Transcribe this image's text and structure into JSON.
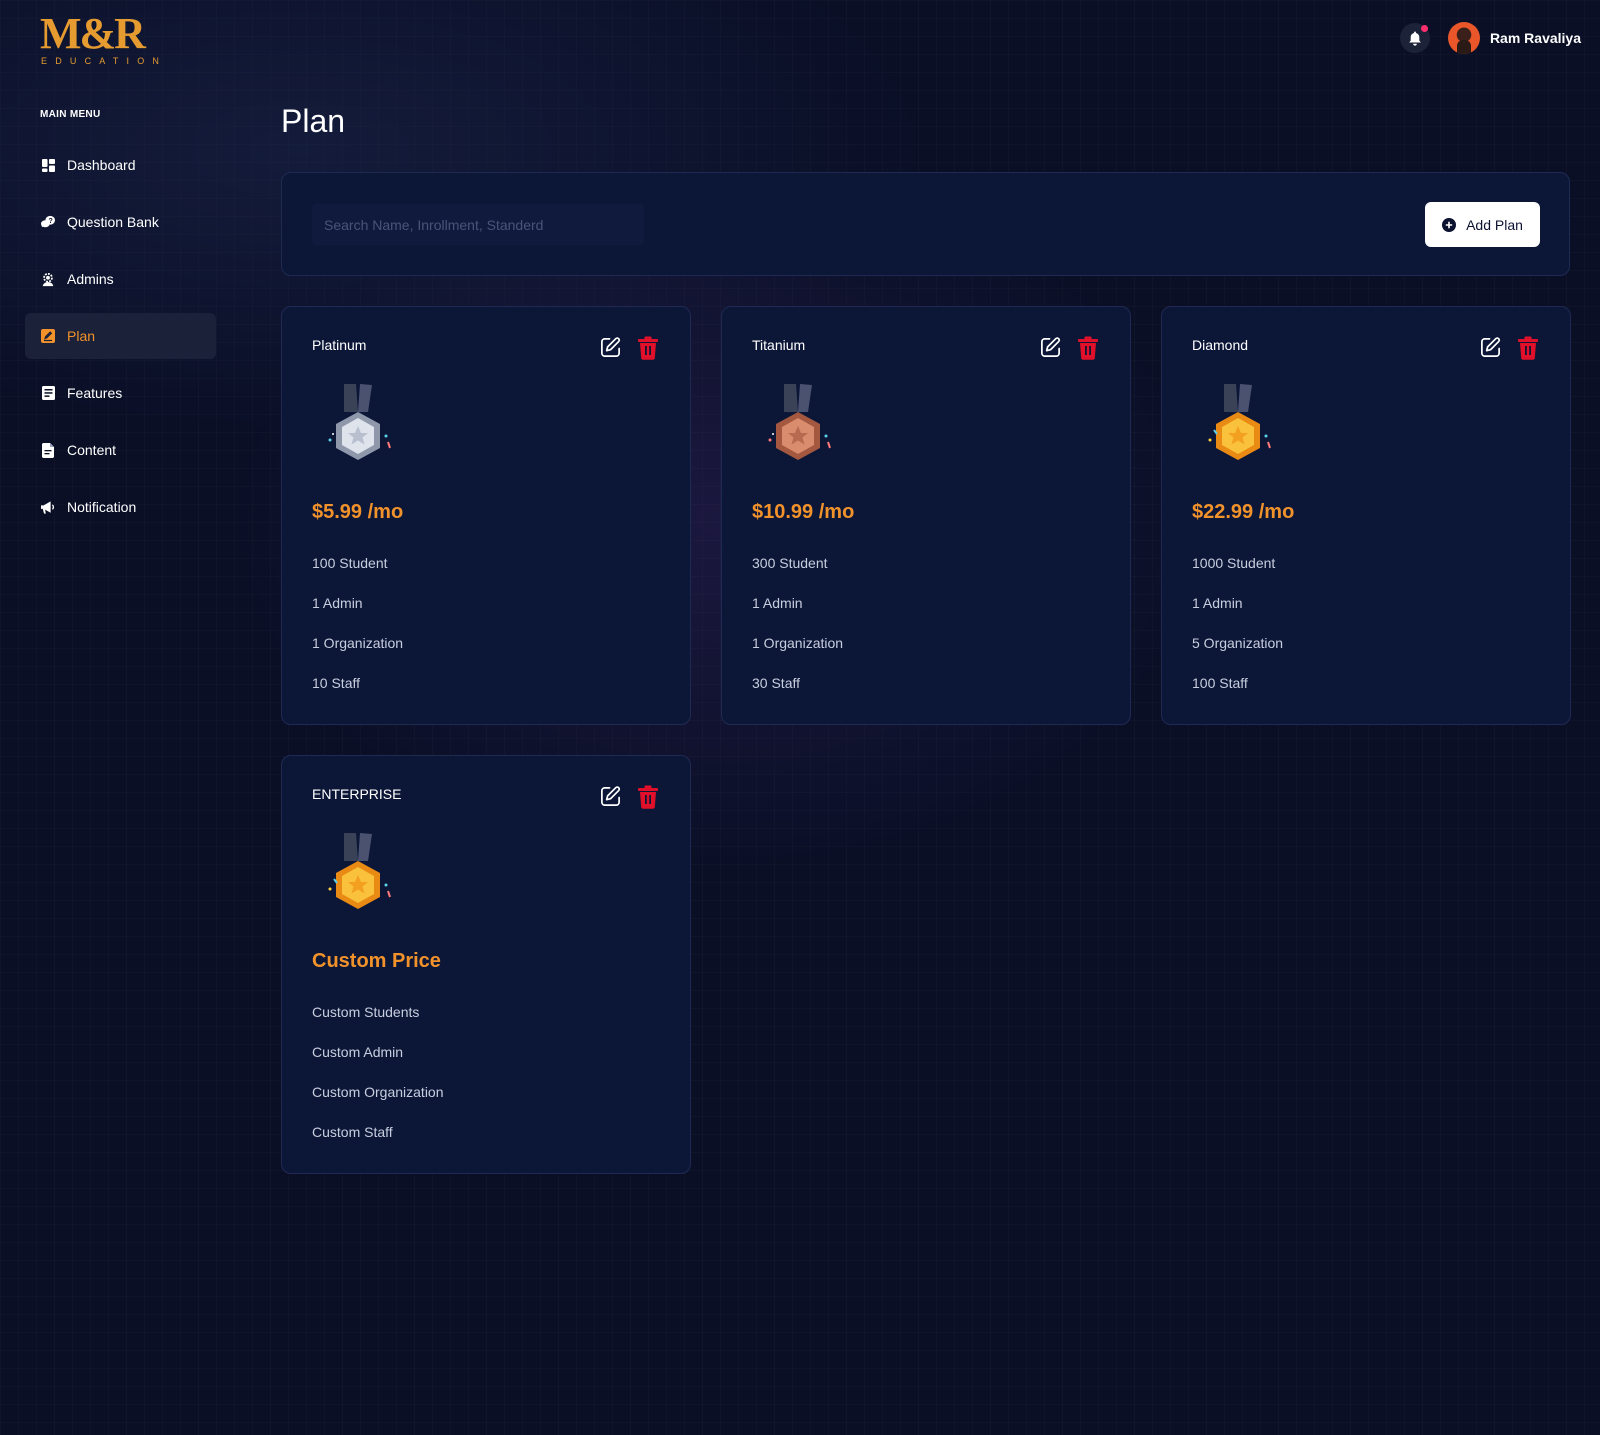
{
  "logo": {
    "main": "M&R",
    "sub": "EDUCATION"
  },
  "user": {
    "name": "Ram Ravaliya"
  },
  "sidebar": {
    "title": "MAIN MENU",
    "items": [
      {
        "label": "Dashboard",
        "icon": "dashboard-icon"
      },
      {
        "label": "Question Bank",
        "icon": "question-bank-icon"
      },
      {
        "label": "Admins",
        "icon": "admin-icon"
      },
      {
        "label": "Plan",
        "icon": "plan-icon",
        "active": true
      },
      {
        "label": "Features",
        "icon": "features-icon"
      },
      {
        "label": "Content",
        "icon": "content-icon"
      },
      {
        "label": "Notification",
        "icon": "megaphone-icon"
      }
    ]
  },
  "page": {
    "title": "Plan"
  },
  "toolbar": {
    "search_placeholder": "Search Name, Inrollment, Standerd",
    "add_label": "Add Plan"
  },
  "plans": [
    {
      "name": "Platinum",
      "price": "$5.99 /mo",
      "medal": "silver",
      "features": [
        "100 Student",
        "1 Admin",
        "1 Organization",
        "10 Staff"
      ]
    },
    {
      "name": "Titanium",
      "price": "$10.99 /mo",
      "medal": "bronze",
      "features": [
        "300 Student",
        "1 Admin",
        "1 Organization",
        "30 Staff"
      ]
    },
    {
      "name": "Diamond",
      "price": "$22.99 /mo",
      "medal": "gold",
      "features": [
        "1000 Student",
        "1 Admin",
        "5 Organization",
        "100 Staff"
      ]
    },
    {
      "name": "ENTERPRISE",
      "price": "Custom Price",
      "medal": "gold",
      "features": [
        "Custom Students",
        "Custom Admin",
        "Custom Organization",
        "Custom Staff"
      ]
    }
  ],
  "colors": {
    "accent": "#f2922b",
    "background": "#0a0f26",
    "card": "#0c1738",
    "delete": "#e0102a",
    "notification_dot": "#ff2f6e"
  }
}
